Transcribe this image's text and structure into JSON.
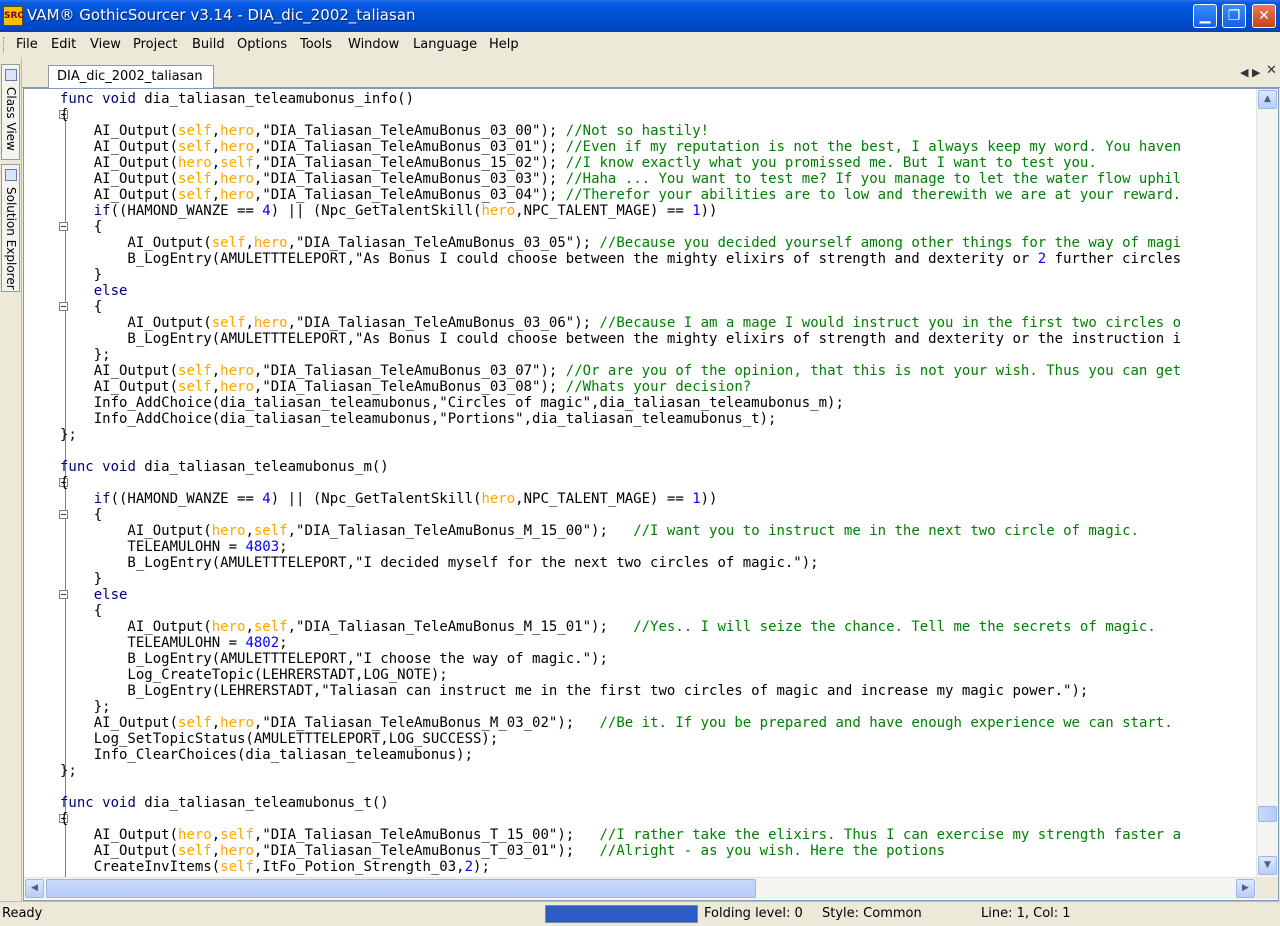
{
  "window": {
    "title": "VAM® GothicSourcer v3.14 - DIA_dic_2002_taliasan",
    "app_icon_text": "SRC",
    "controls": [
      "minimize",
      "maximize",
      "close"
    ]
  },
  "menubar": {
    "items": [
      "File",
      "Edit",
      "View",
      "Project",
      "Build",
      "Options",
      "Tools",
      "Window",
      "Language",
      "Help"
    ]
  },
  "left_dock": {
    "tabs": [
      {
        "label": "Class View",
        "icon": "class-view-icon"
      },
      {
        "label": "Solution Explorer",
        "icon": "solution-explorer-icon"
      }
    ]
  },
  "document": {
    "tab_label": "DIA_dic_2002_taliasan",
    "tab_controls": [
      "prev-tab",
      "next-tab",
      "close-tab"
    ]
  },
  "syntax_colors": {
    "keyword": "#000080",
    "comment": "#008000",
    "string": "#000000",
    "number": "#0000ff",
    "self_hero": "#ffa500",
    "function": "#000000"
  },
  "code_lines": [
    "func void dia_taliasan_teleamubonus_info()",
    "{",
    "    AI_Output(self,hero,\"DIA_Taliasan_TeleAmuBonus_03_00\"); //Not so hastily!",
    "    AI_Output(self,hero,\"DIA_Taliasan_TeleAmuBonus_03_01\"); //Even if my reputation is not the best, I always keep my word. You haven",
    "    AI_Output(hero,self,\"DIA_Taliasan_TeleAmuBonus_15_02\"); //I know exactly what you promissed me. But I want to test you.",
    "    AI_Output(self,hero,\"DIA_Taliasan_TeleAmuBonus_03_03\"); //Haha ... You want to test me? If you manage to let the water flow uphil",
    "    AI_Output(self,hero,\"DIA_Taliasan_TeleAmuBonus_03_04\"); //Therefor your abilities are to low and therewith we are at your reward.",
    "    if((HAMOND_WANZE == 4) || (Npc_GetTalentSkill(hero,NPC_TALENT_MAGE) == 1))",
    "    {",
    "        AI_Output(self,hero,\"DIA_Taliasan_TeleAmuBonus_03_05\"); //Because you decided yourself among other things for the way of magi",
    "        B_LogEntry(AMULETTTELEPORT,\"As Bonus I could choose between the mighty elixirs of strength and dexterity or 2 further circles",
    "    }",
    "    else",
    "    {",
    "        AI_Output(self,hero,\"DIA_Taliasan_TeleAmuBonus_03_06\"); //Because I am a mage I would instruct you in the first two circles o",
    "        B_LogEntry(AMULETTTELEPORT,\"As Bonus I could choose between the mighty elixirs of strength and dexterity or the instruction i",
    "    };",
    "    AI_Output(self,hero,\"DIA_Taliasan_TeleAmuBonus_03_07\"); //Or are you of the opinion, that this is not your wish. Thus you can get",
    "    AI_Output(self,hero,\"DIA_Taliasan_TeleAmuBonus_03_08\"); //Whats your decision?",
    "    Info_AddChoice(dia_taliasan_teleamubonus,\"Circles of magic\",dia_taliasan_teleamubonus_m);",
    "    Info_AddChoice(dia_taliasan_teleamubonus,\"Portions\",dia_taliasan_teleamubonus_t);",
    "};",
    "",
    "func void dia_taliasan_teleamubonus_m()",
    "{",
    "    if((HAMOND_WANZE == 4) || (Npc_GetTalentSkill(hero,NPC_TALENT_MAGE) == 1))",
    "    {",
    "        AI_Output(hero,self,\"DIA_Taliasan_TeleAmuBonus_M_15_00\");   //I want you to instruct me in the next two circle of magic.",
    "        TELEAMULOHN = 4803;",
    "        B_LogEntry(AMULETTTELEPORT,\"I decided myself for the next two circles of magic.\");",
    "    }",
    "    else",
    "    {",
    "        AI_Output(hero,self,\"DIA_Taliasan_TeleAmuBonus_M_15_01\");   //Yes.. I will seize the chance. Tell me the secrets of magic.",
    "        TELEAMULOHN = 4802;",
    "        B_LogEntry(AMULETTTELEPORT,\"I choose the way of magic.\");",
    "        Log_CreateTopic(LEHRERSTADT,LOG_NOTE);",
    "        B_LogEntry(LEHRERSTADT,\"Taliasan can instruct me in the first two circles of magic and increase my magic power.\");",
    "    };",
    "    AI_Output(self,hero,\"DIA_Taliasan_TeleAmuBonus_M_03_02\");   //Be it. If you be prepared and have enough experience we can start.",
    "    Log_SetTopicStatus(AMULETTTELEPORT,LOG_SUCCESS);",
    "    Info_ClearChoices(dia_taliasan_teleamubonus);",
    "};",
    "",
    "func void dia_taliasan_teleamubonus_t()",
    "{",
    "    AI_Output(hero,self,\"DIA_Taliasan_TeleAmuBonus_T_15_00\");   //I rather take the elixirs. Thus I can exercise my strength faster a",
    "    AI_Output(self,hero,\"DIA_Taliasan_TeleAmuBonus_T_03_01\");   //Alright - as you wish. Here the potions",
    "    CreateInvItems(self,ItFo_Potion_Strength_03,2);"
  ],
  "fold_markers": [
    1,
    8,
    13,
    24,
    26,
    31,
    45
  ],
  "statusbar": {
    "ready": "Ready",
    "progress_fraction": 1.0,
    "folding": "Folding level: 0",
    "style": "Style: Common",
    "position": "Line: 1, Col: 1"
  }
}
